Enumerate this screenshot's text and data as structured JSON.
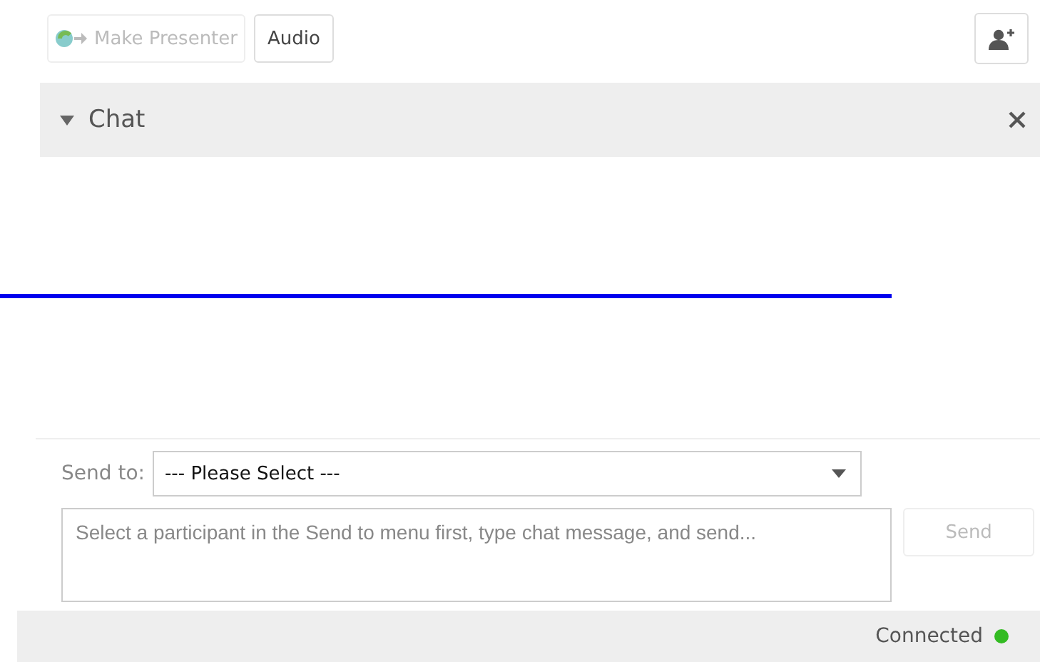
{
  "toolbar": {
    "buttons": [
      {
        "label": "Make Presenter",
        "disabled": true
      },
      {
        "label": "Audio",
        "disabled": false
      }
    ]
  },
  "chat": {
    "title": "Chat",
    "expanded": true,
    "send_to": {
      "label": "Send to:",
      "value": "--- Please Select ---"
    },
    "message": {
      "placeholder": "Select a participant in the Send to menu first, type chat message, and send..."
    },
    "send_button": {
      "label": "Send",
      "disabled": true
    }
  },
  "status_bar": {
    "text": "Connected",
    "color": "#33bb22"
  }
}
